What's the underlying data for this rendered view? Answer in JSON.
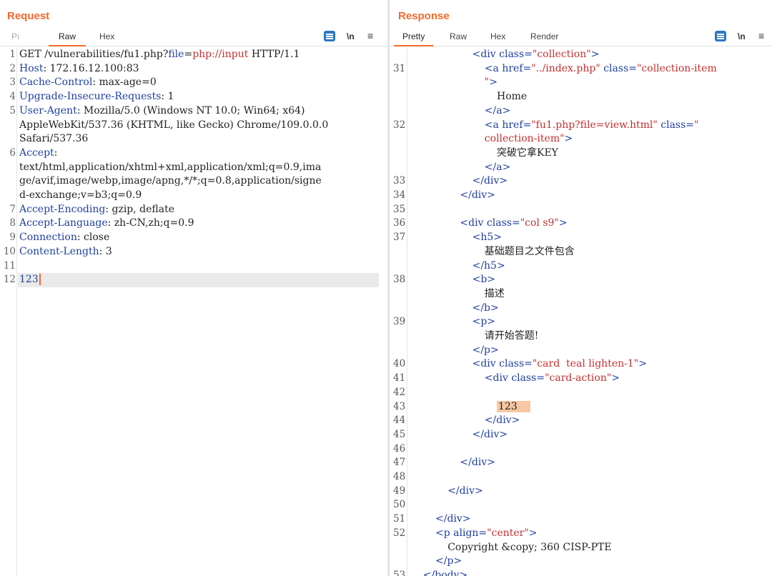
{
  "request": {
    "title": "Request",
    "tabs": [
      "Pretty",
      "Raw",
      "Hex"
    ],
    "tab_pretty_visible": "Pı",
    "active_tab": "Raw",
    "newline_label": "\\n",
    "lines": [
      {
        "n": "1",
        "parts": [
          {
            "c": "v",
            "t": "GET /vulnerabilities/fu1.php?"
          },
          {
            "c": "k",
            "t": "file"
          },
          {
            "c": "v",
            "t": "="
          },
          {
            "c": "red",
            "t": "php://input"
          },
          {
            "c": "v",
            "t": " HTTP/1.1"
          }
        ]
      },
      {
        "n": "2",
        "parts": [
          {
            "c": "k",
            "t": "Host"
          },
          {
            "c": "v",
            "t": ": 172.16.12.100:83"
          }
        ]
      },
      {
        "n": "3",
        "parts": [
          {
            "c": "k",
            "t": "Cache-Control"
          },
          {
            "c": "v",
            "t": ": max-age=0"
          }
        ]
      },
      {
        "n": "4",
        "parts": [
          {
            "c": "k",
            "t": "Upgrade-Insecure-Requests"
          },
          {
            "c": "v",
            "t": ": 1"
          }
        ]
      },
      {
        "n": "5",
        "parts": [
          {
            "c": "k",
            "t": "User-Agent"
          },
          {
            "c": "v",
            "t": ": Mozilla/5.0 (Windows NT 10.0; Win64; x64)"
          }
        ]
      },
      {
        "n": "",
        "parts": [
          {
            "c": "v",
            "t": "AppleWebKit/537.36 (KHTML, like Gecko) Chrome/109.0.0.0"
          }
        ]
      },
      {
        "n": "",
        "parts": [
          {
            "c": "v",
            "t": "Safari/537.36"
          }
        ]
      },
      {
        "n": "6",
        "parts": [
          {
            "c": "k",
            "t": "Accept"
          },
          {
            "c": "v",
            "t": ":"
          }
        ]
      },
      {
        "n": "",
        "parts": [
          {
            "c": "v",
            "t": "text/html,application/xhtml+xml,application/xml;q=0.9,ima"
          }
        ]
      },
      {
        "n": "",
        "parts": [
          {
            "c": "v",
            "t": "ge/avif,image/webp,image/apng,*/*;q=0.8,application/signe"
          }
        ]
      },
      {
        "n": "",
        "parts": [
          {
            "c": "v",
            "t": "d-exchange;v=b3;q=0.9"
          }
        ]
      },
      {
        "n": "7",
        "parts": [
          {
            "c": "k",
            "t": "Accept-Encoding"
          },
          {
            "c": "v",
            "t": ": gzip, deflate"
          }
        ]
      },
      {
        "n": "8",
        "parts": [
          {
            "c": "k",
            "t": "Accept-Language"
          },
          {
            "c": "v",
            "t": ": zh-CN,zh;q=0.9"
          }
        ]
      },
      {
        "n": "9",
        "parts": [
          {
            "c": "k",
            "t": "Connection"
          },
          {
            "c": "v",
            "t": ": close"
          }
        ]
      },
      {
        "n": "10",
        "parts": [
          {
            "c": "k",
            "t": "Content-Length"
          },
          {
            "c": "v",
            "t": ": 3"
          }
        ]
      },
      {
        "n": "11",
        "parts": []
      },
      {
        "n": "12",
        "parts": [
          {
            "c": "k",
            "t": "123"
          }
        ],
        "highlight": true,
        "caret": true
      }
    ]
  },
  "response": {
    "title": "Response",
    "tabs": [
      "Pretty",
      "Raw",
      "Hex",
      "Render"
    ],
    "active_tab": "Pretty",
    "newline_label": "\\n",
    "lines": [
      {
        "n": "",
        "indent": 6,
        "parts": [
          {
            "c": "tag",
            "t": "<div "
          },
          {
            "c": "attr",
            "t": "class="
          },
          {
            "c": "str",
            "t": "\"collection\""
          },
          {
            "c": "tag",
            "t": ">"
          }
        ]
      },
      {
        "n": "31",
        "indent": 8,
        "parts": [
          {
            "c": "tag",
            "t": "<a "
          },
          {
            "c": "attr",
            "t": "href="
          },
          {
            "c": "str",
            "t": "\"../index.php\""
          },
          {
            "c": "attr",
            "t": " class="
          },
          {
            "c": "str",
            "t": "\"collection-item"
          }
        ]
      },
      {
        "n": "",
        "indent": 8,
        "parts": [
          {
            "c": "str",
            "t": "\""
          },
          {
            "c": "tag",
            "t": ">"
          }
        ]
      },
      {
        "n": "",
        "indent": 10,
        "parts": [
          {
            "c": "plain",
            "t": "Home"
          }
        ]
      },
      {
        "n": "",
        "indent": 8,
        "parts": [
          {
            "c": "tag",
            "t": "</a>"
          }
        ]
      },
      {
        "n": "32",
        "indent": 8,
        "parts": [
          {
            "c": "tag",
            "t": "<a "
          },
          {
            "c": "attr",
            "t": "href="
          },
          {
            "c": "str",
            "t": "\"fu1.php?file=view.html\""
          },
          {
            "c": "attr",
            "t": " class="
          },
          {
            "c": "str",
            "t": "\""
          }
        ]
      },
      {
        "n": "",
        "indent": 8,
        "parts": [
          {
            "c": "str",
            "t": "collection-item\""
          },
          {
            "c": "tag",
            "t": ">"
          }
        ]
      },
      {
        "n": "",
        "indent": 10,
        "parts": [
          {
            "c": "plain",
            "t": "突破它拿KEY"
          }
        ]
      },
      {
        "n": "",
        "indent": 8,
        "parts": [
          {
            "c": "tag",
            "t": "</a>"
          }
        ]
      },
      {
        "n": "33",
        "indent": 6,
        "parts": [
          {
            "c": "tag",
            "t": "</div>"
          }
        ]
      },
      {
        "n": "34",
        "indent": 4,
        "parts": [
          {
            "c": "tag",
            "t": "</div>"
          }
        ]
      },
      {
        "n": "35",
        "indent": 0,
        "parts": []
      },
      {
        "n": "36",
        "indent": 4,
        "parts": [
          {
            "c": "tag",
            "t": "<div "
          },
          {
            "c": "attr",
            "t": "class="
          },
          {
            "c": "str",
            "t": "\"col s9\""
          },
          {
            "c": "tag",
            "t": ">"
          }
        ]
      },
      {
        "n": "37",
        "indent": 6,
        "parts": [
          {
            "c": "tag",
            "t": "<h5>"
          }
        ]
      },
      {
        "n": "",
        "indent": 8,
        "parts": [
          {
            "c": "plain",
            "t": "基础题目之文件包含"
          }
        ]
      },
      {
        "n": "",
        "indent": 6,
        "parts": [
          {
            "c": "tag",
            "t": "</h5>"
          }
        ]
      },
      {
        "n": "38",
        "indent": 6,
        "parts": [
          {
            "c": "tag",
            "t": "<b>"
          }
        ]
      },
      {
        "n": "",
        "indent": 8,
        "parts": [
          {
            "c": "plain",
            "t": "描述"
          }
        ]
      },
      {
        "n": "",
        "indent": 6,
        "parts": [
          {
            "c": "tag",
            "t": "</b>"
          }
        ]
      },
      {
        "n": "39",
        "indent": 6,
        "parts": [
          {
            "c": "tag",
            "t": "<p>"
          }
        ]
      },
      {
        "n": "",
        "indent": 8,
        "parts": [
          {
            "c": "plain",
            "t": "请开始答题!"
          }
        ]
      },
      {
        "n": "",
        "indent": 6,
        "parts": [
          {
            "c": "tag",
            "t": "</p>"
          }
        ]
      },
      {
        "n": "40",
        "indent": 6,
        "parts": [
          {
            "c": "tag",
            "t": "<div "
          },
          {
            "c": "attr",
            "t": "class="
          },
          {
            "c": "str",
            "t": "\"card  teal lighten-1\""
          },
          {
            "c": "tag",
            "t": ">"
          }
        ]
      },
      {
        "n": "41",
        "indent": 8,
        "parts": [
          {
            "c": "tag",
            "t": "<div "
          },
          {
            "c": "attr",
            "t": "class="
          },
          {
            "c": "str",
            "t": "\"card-action\""
          },
          {
            "c": "tag",
            "t": ">"
          }
        ]
      },
      {
        "n": "42",
        "indent": 0,
        "parts": []
      },
      {
        "n": "43",
        "indent": 10,
        "parts": [
          {
            "c": "plain",
            "t": "123",
            "hl": true
          }
        ]
      },
      {
        "n": "44",
        "indent": 8,
        "parts": [
          {
            "c": "tag",
            "t": "</div>"
          }
        ]
      },
      {
        "n": "45",
        "indent": 6,
        "parts": [
          {
            "c": "tag",
            "t": "</div>"
          }
        ]
      },
      {
        "n": "46",
        "indent": 0,
        "parts": []
      },
      {
        "n": "47",
        "indent": 4,
        "parts": [
          {
            "c": "tag",
            "t": "</div>"
          }
        ]
      },
      {
        "n": "48",
        "indent": 0,
        "parts": []
      },
      {
        "n": "49",
        "indent": 2,
        "parts": [
          {
            "c": "tag",
            "t": "</div>"
          }
        ]
      },
      {
        "n": "50",
        "indent": 0,
        "parts": []
      },
      {
        "n": "51",
        "indent": 0,
        "parts": [
          {
            "c": "tag",
            "t": "</div>"
          }
        ]
      },
      {
        "n": "52",
        "indent": 0,
        "parts": [
          {
            "c": "tag",
            "t": "<p "
          },
          {
            "c": "attr",
            "t": "align="
          },
          {
            "c": "str",
            "t": "\"center\""
          },
          {
            "c": "tag",
            "t": ">"
          }
        ]
      },
      {
        "n": "",
        "indent": 2,
        "parts": [
          {
            "c": "plain",
            "t": "Copyright &copy; 360 CISP-PTE"
          }
        ]
      },
      {
        "n": "",
        "indent": 0,
        "parts": [
          {
            "c": "tag",
            "t": "</p>"
          }
        ]
      },
      {
        "n": "53",
        "indent": -2,
        "parts": [
          {
            "c": "tag",
            "t": "</body>"
          }
        ]
      }
    ]
  },
  "layout_buttons": [
    "split-view",
    "horizontal-view",
    "vertical-view"
  ],
  "colors": {
    "accent": "#f26a2a",
    "tag_blue": "#1f3fa0",
    "string_red": "#c63030",
    "highlight": "#f7c8a3"
  }
}
